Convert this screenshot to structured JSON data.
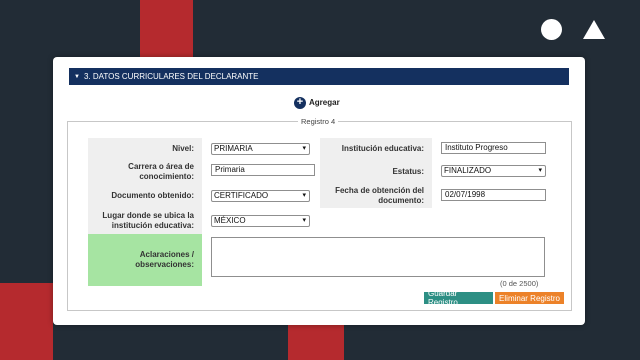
{
  "colors": {
    "header": "#14305f",
    "save": "#2d8f84",
    "delete": "#ec8229",
    "aclaraciones_label": "#a6e4a2",
    "bg": "#222c36",
    "red": "#b52a2e"
  },
  "section": {
    "title": "3. DATOS CURRICULARES DEL DECLARANTE"
  },
  "add": {
    "label": "Agregar"
  },
  "record": {
    "legend": "Registro 4"
  },
  "form": {
    "nivel": {
      "label": "Nivel:",
      "value": "PRIMARIA"
    },
    "institucion": {
      "label": "Institución educativa:",
      "value": "Instituto Progreso"
    },
    "carrera": {
      "label": "Carrera o área de conocimiento:",
      "value": "Primaria"
    },
    "estatus": {
      "label": "Estatus:",
      "value": "FINALIZADO"
    },
    "documento": {
      "label": "Documento obtenido:",
      "value": "CERTIFICADO"
    },
    "fecha": {
      "label": "Fecha de obtención del documento:",
      "value": "02/07/1998"
    },
    "lugar": {
      "label": "Lugar donde se ubica la institución educativa:",
      "value": "MÉXICO"
    },
    "aclaraciones": {
      "label": "Aclaraciones / observaciones:",
      "value": "",
      "counter": "(0 de 2500)"
    }
  },
  "buttons": {
    "save": "Guardar Registro",
    "delete": "Eliminar Registro"
  }
}
